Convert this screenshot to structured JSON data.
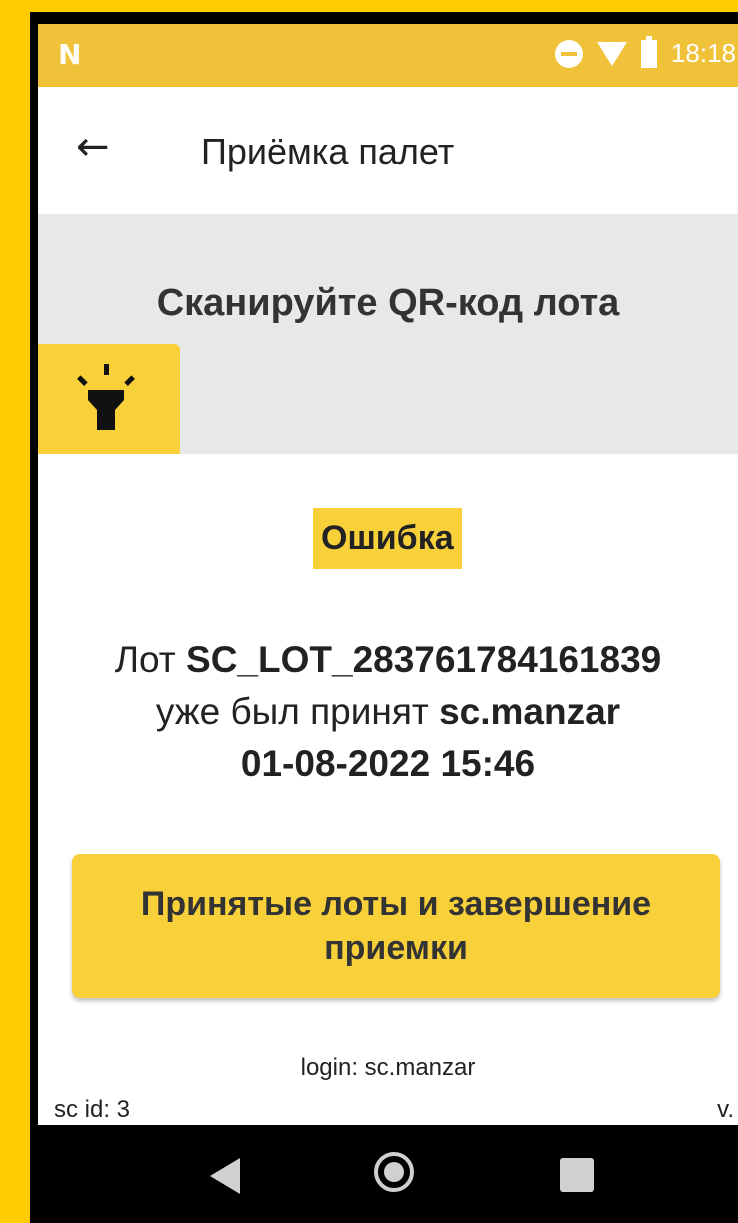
{
  "status_bar": {
    "left_icon": "N",
    "time": "18:18",
    "icons": [
      "do-not-disturb-icon",
      "wifi-icon",
      "battery-icon"
    ]
  },
  "app_bar": {
    "back_icon": "←",
    "title": "Приёмка палет"
  },
  "scan": {
    "prompt": "Сканируйте QR-код лота",
    "flashlight_icon": "flashlight-icon"
  },
  "error": {
    "badge": "Ошибка",
    "lot_prefix": "Лот ",
    "lot_id": "SC_LOT_283761784161839",
    "accepted_text": "уже был принят ",
    "user": "sc.manzar",
    "datetime": "01-08-2022 15:46"
  },
  "action_button": {
    "label": "Принятые лоты и завершение приемки"
  },
  "footer": {
    "login": "login: sc.manzar",
    "sc_id": "sc id: 3",
    "version": "v."
  },
  "colors": {
    "accent": "#f7d03a",
    "status_bar": "#f0c23a",
    "border": "#ffcc00"
  }
}
